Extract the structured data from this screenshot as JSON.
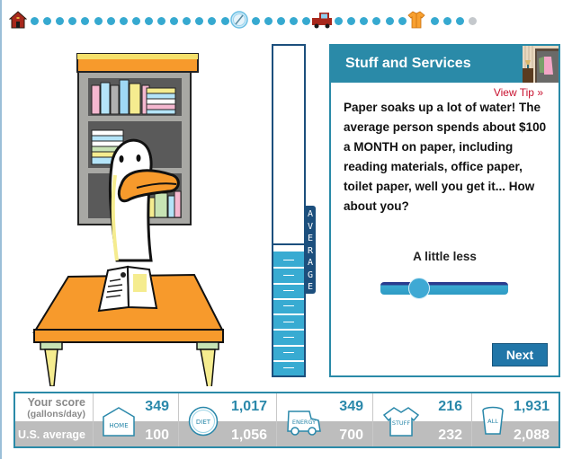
{
  "progress": {
    "milestones": [
      {
        "name": "home",
        "icon": "house-icon",
        "status": "done"
      },
      {
        "name": "diet",
        "icon": "plate-fork-icon",
        "status": "done"
      },
      {
        "name": "energy",
        "icon": "car-icon",
        "status": "done"
      },
      {
        "name": "stuff",
        "icon": "shirt-icon",
        "status": "current"
      }
    ],
    "dots_after_home": 16,
    "dots_after_diet": 5,
    "dots_after_energy": 6,
    "dots_after_stuff_done": 3,
    "dots_after_stuff_pending": 1,
    "colors": {
      "done": "#36a9d0",
      "pending": "#c4c8cc"
    }
  },
  "illustration": {
    "description": "duck reading a book at an orange desk in front of a bookshelf"
  },
  "meter": {
    "average_label": "AVERAGE",
    "fill_fraction": 0.375,
    "average_fraction": 0.4,
    "color": "#38abd2"
  },
  "panel": {
    "title": "Stuff and Services",
    "header_icon": "closet-icon",
    "view_tip": "View Tip »",
    "tip_text": "Paper soaks up a lot of water! The average person spends about $100 a MONTH on paper, including reading materials, office paper, toilet paper, well you get it... How about you?",
    "slider": {
      "label": "A little less",
      "value_fraction": 0.25
    },
    "next_label": "Next",
    "colors": {
      "header": "#2a8aa8",
      "tip_link": "#c8102e",
      "button": "#2176a8"
    }
  },
  "score": {
    "row_labels": {
      "your_score": "Your score",
      "units": "(gallons/day)",
      "us_average": "U.S. average"
    },
    "categories": [
      {
        "key": "home",
        "icon_label": "HOME",
        "icon": "house-outline-icon",
        "your_score": "349",
        "us_average": "100"
      },
      {
        "key": "diet",
        "icon_label": "DIET",
        "icon": "plate-outline-icon",
        "your_score": "1,017",
        "us_average": "1,056"
      },
      {
        "key": "energy",
        "icon_label": "ENERGY",
        "icon": "car-outline-icon",
        "your_score": "349",
        "us_average": "700"
      },
      {
        "key": "stuff",
        "icon_label": "STUFF",
        "icon": "shirt-outline-icon",
        "your_score": "216",
        "us_average": "232"
      },
      {
        "key": "all",
        "icon_label": "ALL",
        "icon": "cup-outline-icon",
        "your_score": "1,931",
        "us_average": "2,088"
      }
    ]
  }
}
